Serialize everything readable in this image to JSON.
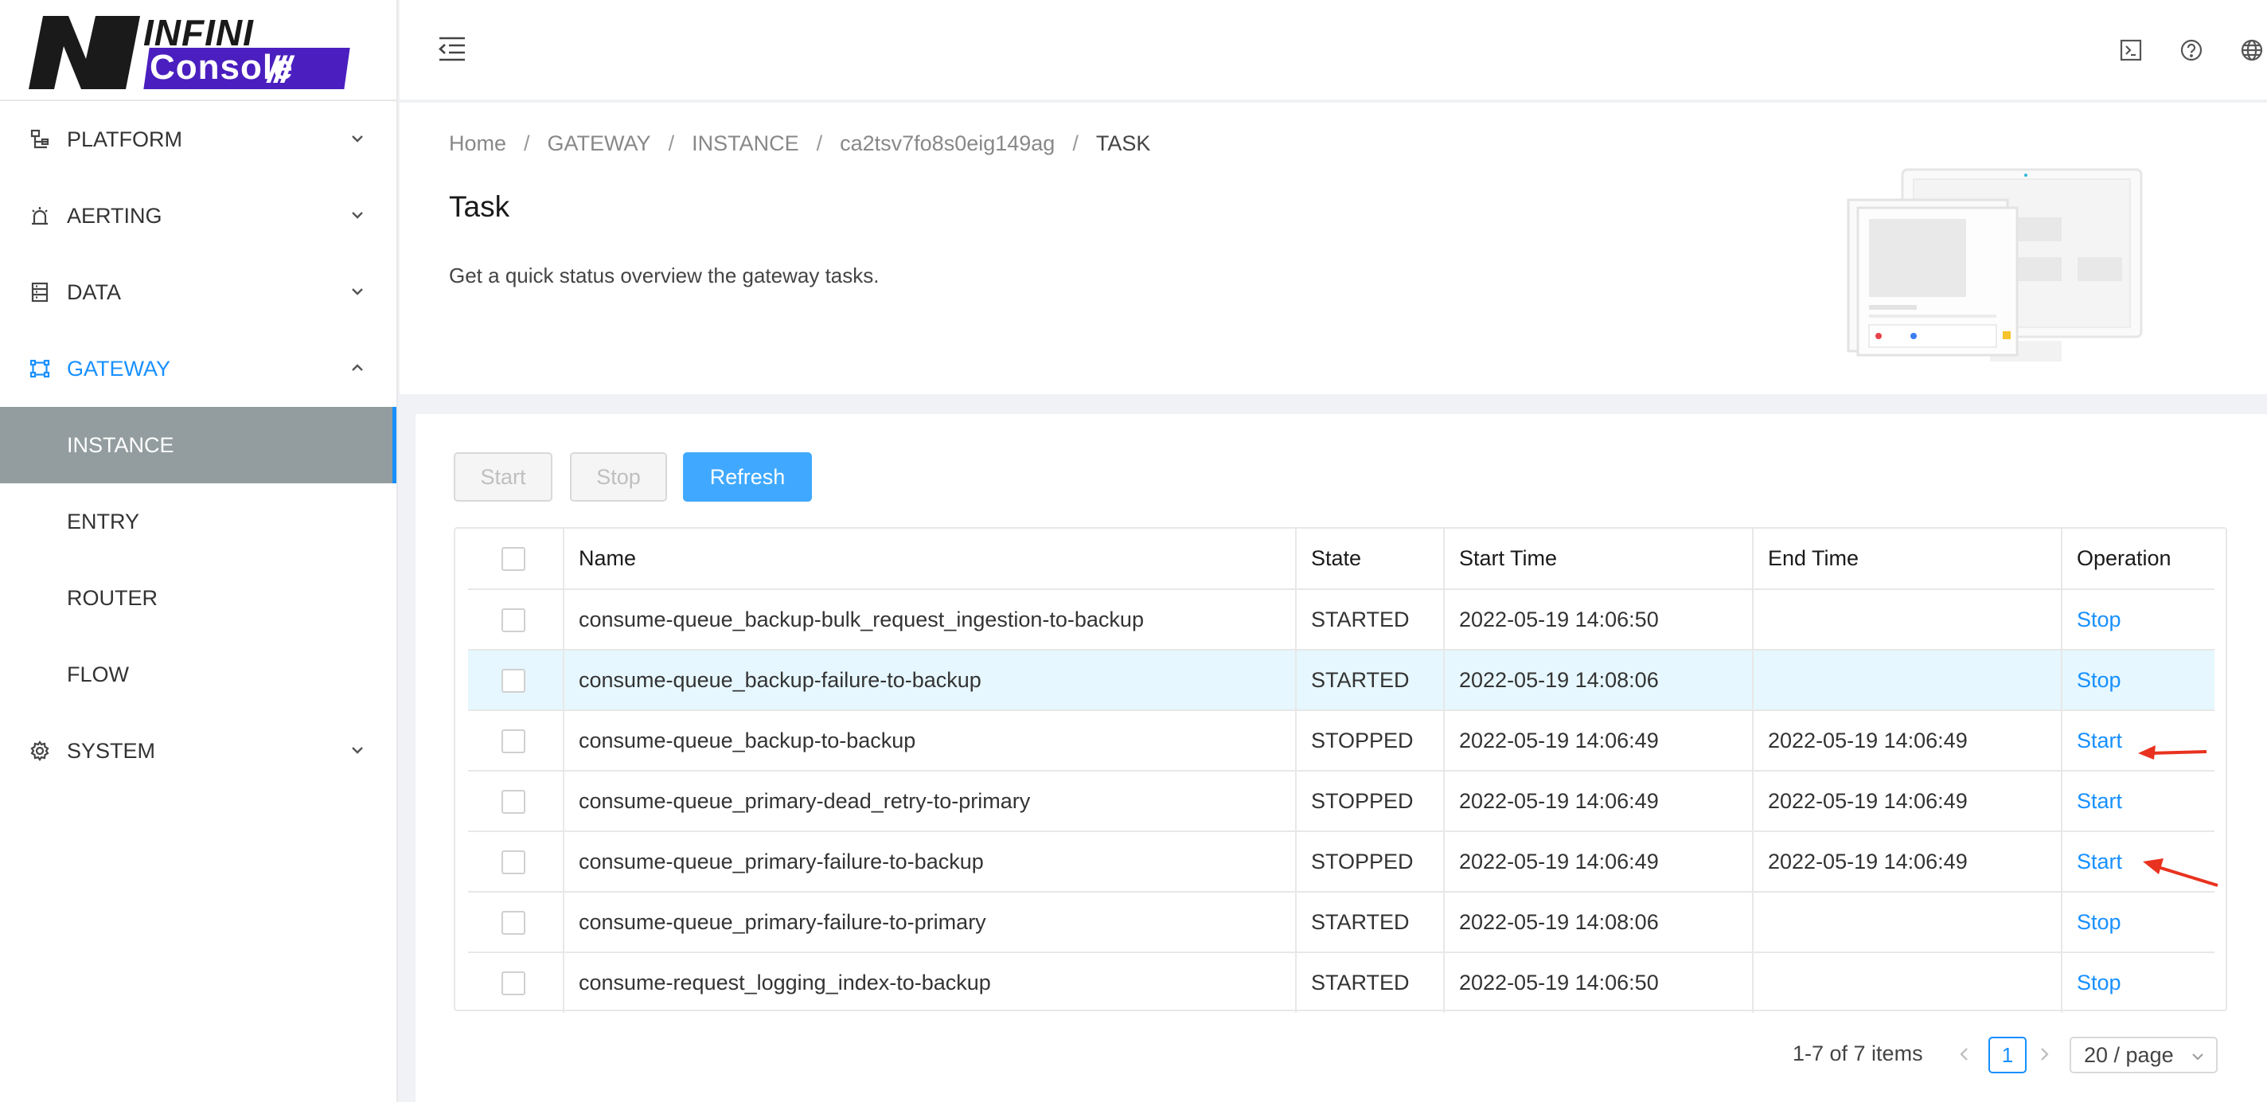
{
  "logo": {
    "line1": "INFINI",
    "line2": "Console",
    "slashes": "///"
  },
  "sidebar": {
    "items": [
      {
        "label": "PLATFORM",
        "icon": "platform-icon",
        "expanded": false
      },
      {
        "label": "AERTING",
        "icon": "alarm-icon",
        "expanded": false
      },
      {
        "label": "DATA",
        "icon": "database-icon",
        "expanded": false
      },
      {
        "label": "GATEWAY",
        "icon": "gateway-icon",
        "expanded": true
      },
      {
        "label": "SYSTEM",
        "icon": "gear-icon",
        "expanded": false
      }
    ],
    "gateway_children": [
      "INSTANCE",
      "ENTRY",
      "ROUTER",
      "FLOW"
    ],
    "selected": "INSTANCE"
  },
  "header": {
    "icons": [
      "collapse-menu-icon",
      "terminal-icon",
      "help-icon",
      "globe-icon"
    ]
  },
  "breadcrumb": [
    "Home",
    "GATEWAY",
    "INSTANCE",
    "ca2tsv7fo8s0eig149ag",
    "TASK"
  ],
  "page": {
    "title": "Task",
    "description": "Get a quick status overview the gateway tasks."
  },
  "toolbar": {
    "start_label": "Start",
    "stop_label": "Stop",
    "refresh_label": "Refresh"
  },
  "table": {
    "columns": [
      "Name",
      "State",
      "Start Time",
      "End Time",
      "Operation"
    ],
    "rows": [
      {
        "name": "consume-queue_backup-bulk_request_ingestion-to-backup",
        "state": "STARTED",
        "start": "2022-05-19 14:06:50",
        "end": "",
        "op": "Stop"
      },
      {
        "name": "consume-queue_backup-failure-to-backup",
        "state": "STARTED",
        "start": "2022-05-19 14:08:06",
        "end": "",
        "op": "Stop"
      },
      {
        "name": "consume-queue_backup-to-backup",
        "state": "STOPPED",
        "start": "2022-05-19 14:06:49",
        "end": "2022-05-19 14:06:49",
        "op": "Start"
      },
      {
        "name": "consume-queue_primary-dead_retry-to-primary",
        "state": "STOPPED",
        "start": "2022-05-19 14:06:49",
        "end": "2022-05-19 14:06:49",
        "op": "Start"
      },
      {
        "name": "consume-queue_primary-failure-to-backup",
        "state": "STOPPED",
        "start": "2022-05-19 14:06:49",
        "end": "2022-05-19 14:06:49",
        "op": "Start"
      },
      {
        "name": "consume-queue_primary-failure-to-primary",
        "state": "STARTED",
        "start": "2022-05-19 14:08:06",
        "end": "",
        "op": "Stop"
      },
      {
        "name": "consume-request_logging_index-to-backup",
        "state": "STARTED",
        "start": "2022-05-19 14:06:50",
        "end": "",
        "op": "Stop"
      }
    ]
  },
  "pagination": {
    "total_text": "1-7 of 7 items",
    "current_page": "1",
    "page_size": "20 / page"
  },
  "colors": {
    "accent": "#1890ff",
    "selected_menu_bg": "#939d9f",
    "annotation_arrow": "#e8321f",
    "logo_purple": "#4b1fbf"
  }
}
